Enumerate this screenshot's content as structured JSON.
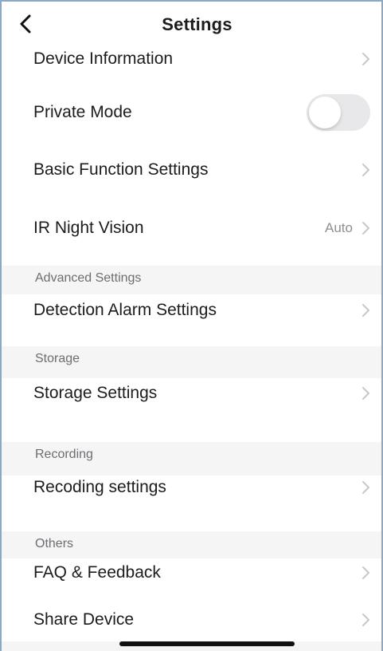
{
  "header": {
    "title": "Settings",
    "back_icon": "chevron-left-icon"
  },
  "rows": {
    "device_information": {
      "label": "Device Information"
    },
    "private_mode": {
      "label": "Private Mode",
      "toggle_on": false
    },
    "basic_function_settings": {
      "label": "Basic Function Settings"
    },
    "ir_night_vision": {
      "label": "IR Night Vision",
      "value": "Auto"
    },
    "detection_alarm_settings": {
      "label": "Detection Alarm Settings"
    },
    "storage_settings": {
      "label": "Storage Settings"
    },
    "recoding_settings": {
      "label": "Recoding settings"
    },
    "faq_feedback": {
      "label": "FAQ & Feedback"
    },
    "share_device": {
      "label": "Share Device"
    }
  },
  "sections": {
    "advanced": "Advanced Settings",
    "storage": "Storage",
    "recording": "Recording",
    "others": "Others"
  },
  "colors": {
    "text": "#1c1c1e",
    "secondary_text": "#8e8e93",
    "section_bg": "#f5f5f6",
    "toggle_off_bg": "#e8e8ea",
    "chevron": "#c7c7cc"
  }
}
